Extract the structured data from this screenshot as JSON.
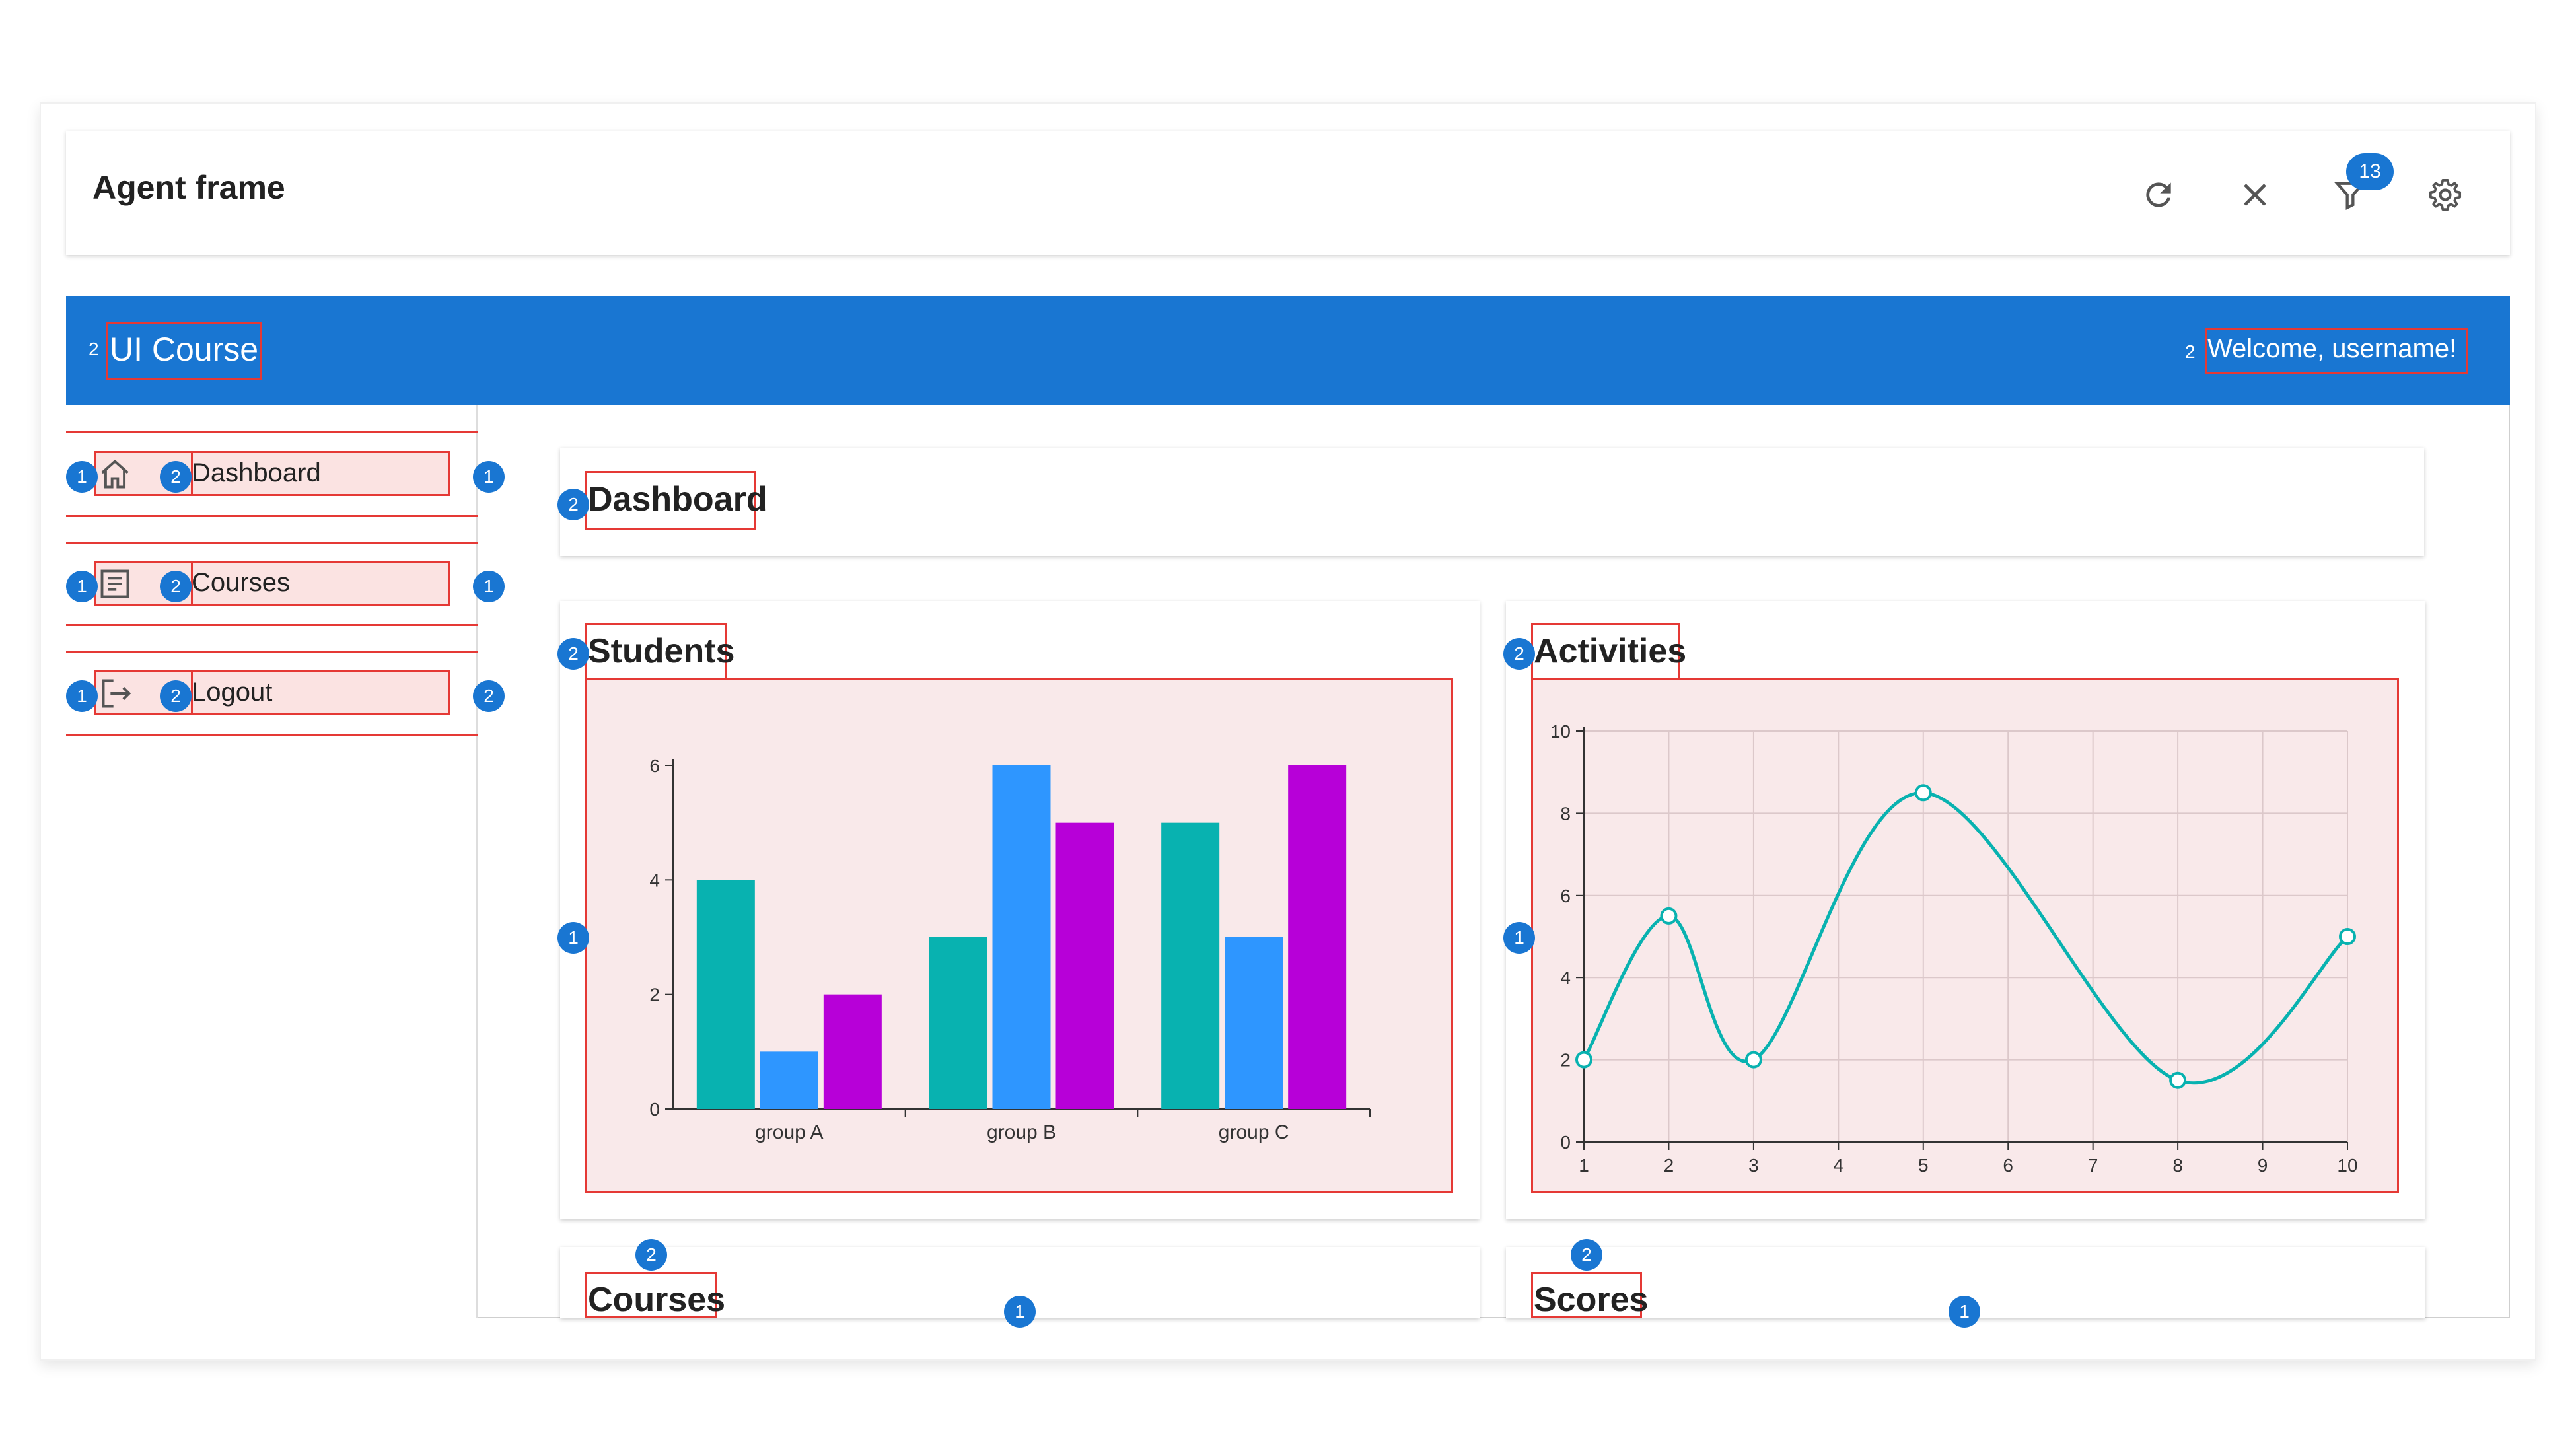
{
  "agent_frame": {
    "title": "Agent frame",
    "filter_count": "13",
    "icons": [
      "refresh-icon",
      "close-icon",
      "filter-icon",
      "gear-icon"
    ]
  },
  "app": {
    "title": "UI Course",
    "welcome": "Welcome, username!",
    "title_marker": "2",
    "welcome_marker": "2"
  },
  "sidebar": {
    "items": [
      {
        "label": "Dashboard",
        "icon": "home-icon",
        "badges": [
          "1",
          "2",
          "1"
        ]
      },
      {
        "label": "Courses",
        "icon": "list-icon",
        "badges": [
          "1",
          "2",
          "1"
        ]
      },
      {
        "label": "Logout",
        "icon": "logout-icon",
        "badges": [
          "1",
          "2",
          "2"
        ]
      }
    ]
  },
  "main": {
    "page_title": "Dashboard",
    "page_title_badge": "2",
    "cards": {
      "students": {
        "title": "Students",
        "title_badge": "2",
        "chart_badge": "1"
      },
      "activities": {
        "title": "Activities",
        "title_badge": "2",
        "chart_badge": "1"
      },
      "courses": {
        "title": "Courses",
        "title_badge": "2",
        "chart_badge": "1"
      },
      "scores": {
        "title": "Scores",
        "title_badge": "2",
        "chart_badge": "1"
      }
    }
  },
  "colors": {
    "primary": "#1976d2",
    "highlight": "#e53935",
    "teal": "#08b2b0",
    "blue": "#2e96ff",
    "purple": "#b700d8"
  },
  "chart_data": [
    {
      "type": "bar",
      "categories": [
        "group A",
        "group B",
        "group C"
      ],
      "series": [
        {
          "values": [
            4,
            3,
            5
          ]
        },
        {
          "values": [
            1,
            6,
            3
          ]
        },
        {
          "values": [
            2,
            5,
            6
          ]
        }
      ],
      "ylim": [
        0,
        6
      ],
      "yticks": [
        0,
        2,
        4,
        6
      ],
      "grid": false
    },
    {
      "type": "line",
      "x": [
        1,
        2,
        3,
        5,
        8,
        10
      ],
      "y": [
        2,
        5.5,
        2,
        8.5,
        1.5,
        5
      ],
      "xlim": [
        1,
        10
      ],
      "ylim": [
        0,
        10
      ],
      "xticks": [
        1,
        2,
        3,
        4,
        5,
        6,
        7,
        8,
        9,
        10
      ],
      "yticks": [
        0,
        2,
        4,
        6,
        8,
        10
      ],
      "grid": true,
      "curve": "smooth"
    }
  ]
}
